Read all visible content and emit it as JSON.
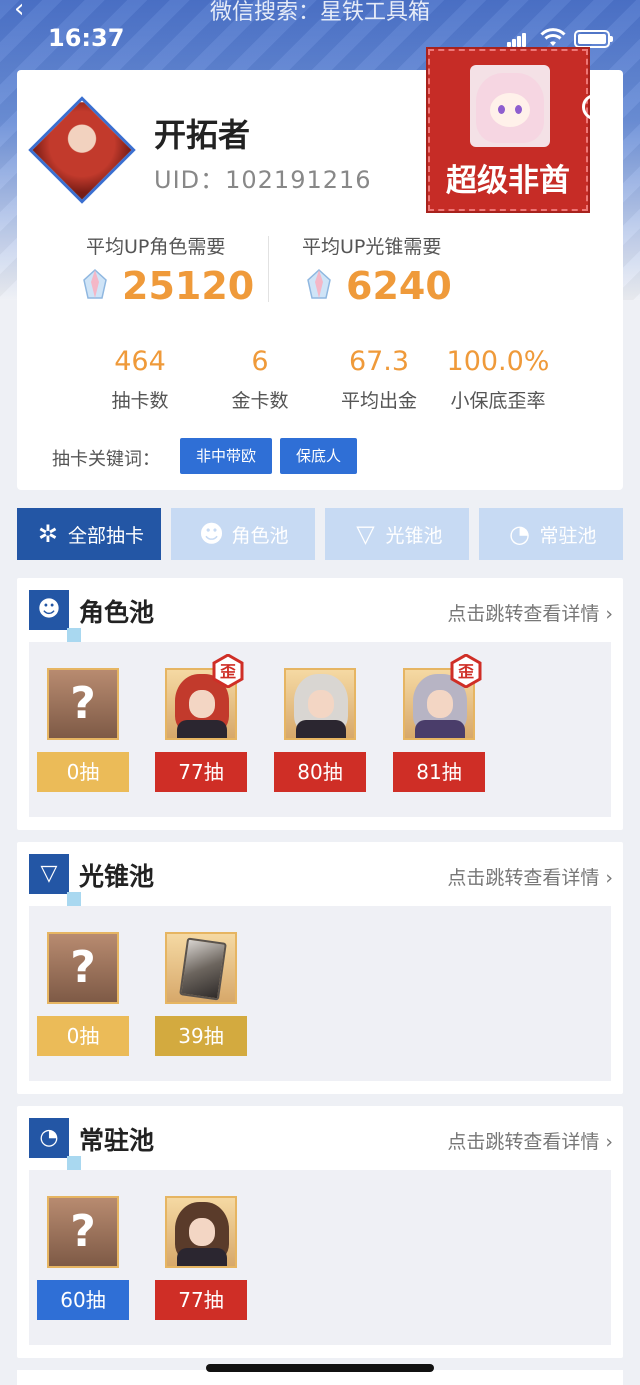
{
  "status_bar": {
    "time": "16:37",
    "back_icon": "chevron-left-icon",
    "hint": "微信搜索：星铁工具箱"
  },
  "profile": {
    "name": "开拓者",
    "uid_label": "UID：",
    "uid": "102191216",
    "badge_text": "超级非酋"
  },
  "needs": {
    "character_label": "平均UP角色需要",
    "character_value": "25120",
    "cone_label": "平均UP光锥需要",
    "cone_value": "6240",
    "currency_icon": "stellar-jade-icon"
  },
  "stats": [
    {
      "value": "464",
      "label": "抽卡数"
    },
    {
      "value": "6",
      "label": "金卡数"
    },
    {
      "value": "67.3",
      "label": "平均出金"
    },
    {
      "value": "100.0%",
      "label": "小保底歪率"
    }
  ],
  "keywords": {
    "label": "抽卡关键词：",
    "tags": [
      "非中带欧",
      "保底人"
    ]
  },
  "tabs": [
    {
      "label": "全部抽卡",
      "icon": "star-burst-icon",
      "active": true
    },
    {
      "label": "角色池",
      "icon": "character-head-icon",
      "active": false
    },
    {
      "label": "光锥池",
      "icon": "light-cone-icon",
      "active": false
    },
    {
      "label": "常驻池",
      "icon": "refresh-circle-icon",
      "active": false
    }
  ],
  "detail_link": "点击跳转查看详情",
  "pools": [
    {
      "title": "角色池",
      "items": [
        {
          "kind": "unknown",
          "count": "0抽",
          "color": "yellow"
        },
        {
          "kind": "char-red",
          "count": "77抽",
          "color": "red",
          "lost_badge": "歪"
        },
        {
          "kind": "char-white",
          "count": "80抽",
          "color": "red"
        },
        {
          "kind": "char-silver",
          "count": "81抽",
          "color": "red",
          "lost_badge": "歪"
        }
      ]
    },
    {
      "title": "光锥池",
      "items": [
        {
          "kind": "unknown",
          "count": "0抽",
          "color": "yellow"
        },
        {
          "kind": "cone",
          "count": "39抽",
          "color": "gold"
        }
      ]
    },
    {
      "title": "常驻池",
      "items": [
        {
          "kind": "unknown",
          "count": "60抽",
          "color": "blue"
        },
        {
          "kind": "char-brown",
          "count": "77抽",
          "color": "red"
        }
      ]
    }
  ],
  "colors": {
    "accent_blue": "#2356a5",
    "tab_inactive": "#c7daf3",
    "orange_value": "#ef9a3a",
    "count_red": "#cf2e26",
    "count_yellow": "#ebbb58",
    "count_gold": "#d3aa3f",
    "count_blue": "#2f6fd6",
    "badge_red": "#c62c26"
  }
}
